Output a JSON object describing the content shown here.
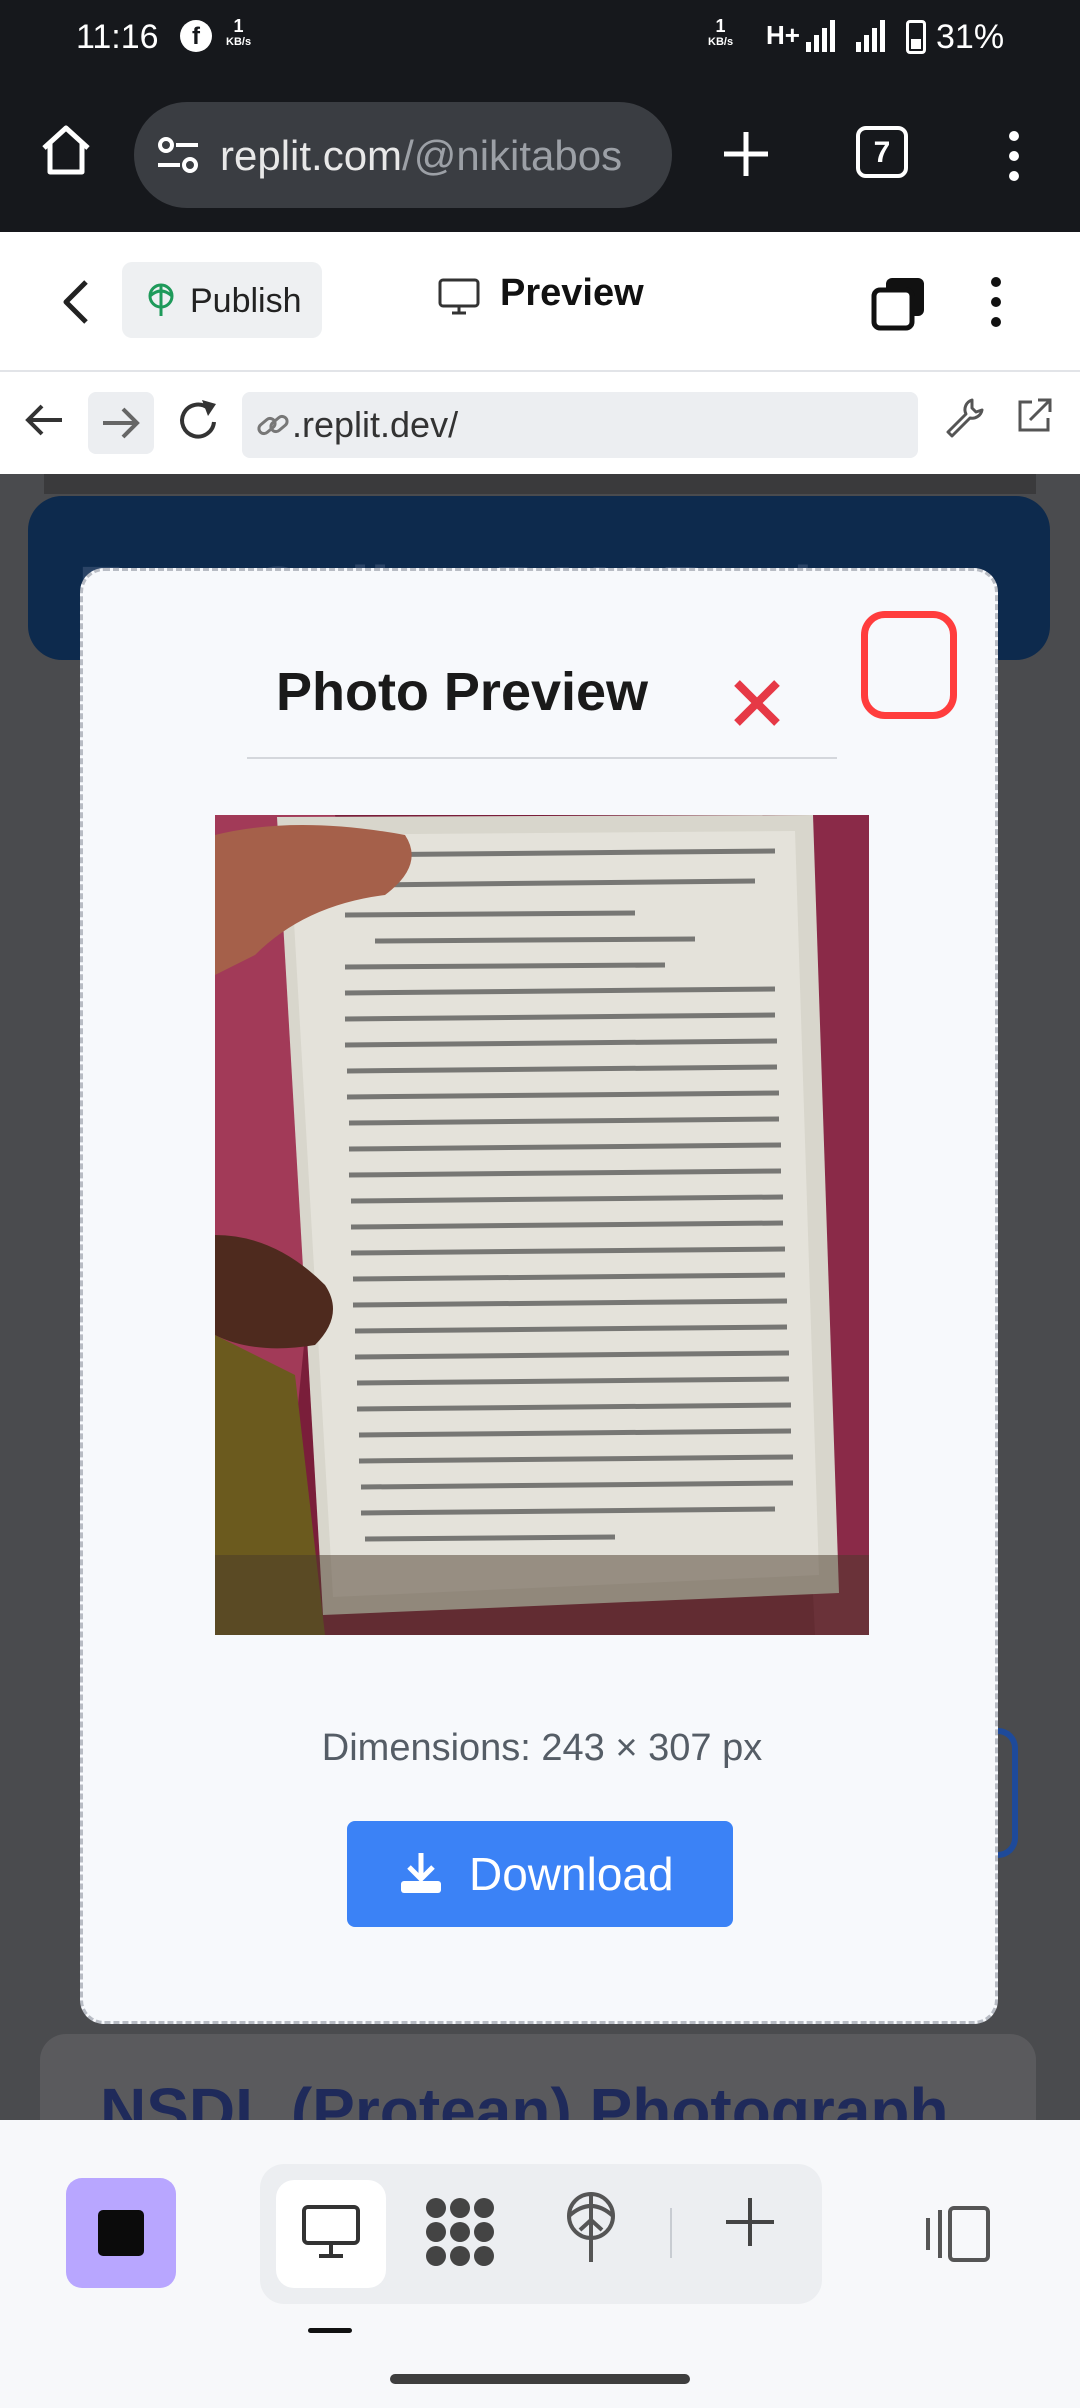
{
  "status_bar": {
    "time": "11:16",
    "net_speed_left": {
      "value": "1",
      "unit": "KB/s"
    },
    "net_speed_right": {
      "value": "1",
      "unit": "KB/s"
    },
    "network_type": "H+",
    "battery": "31%"
  },
  "browser": {
    "url_domain": "replit.com",
    "url_path": "/@nikitabos",
    "tab_count": "7"
  },
  "replit_header": {
    "publish_label": "Publish",
    "preview_label": "Preview"
  },
  "webview": {
    "url": ".replit.dev/"
  },
  "background_page": {
    "banner_text": "Free Online PAN Resizer",
    "section_heading": "NSDL (Protean) Photograph"
  },
  "modal": {
    "title": "Photo Preview",
    "dimensions_text": "Dimensions: 243 × 307 px",
    "download_label": "Download"
  },
  "colors": {
    "accent_blue": "#3b82f6",
    "close_red": "#e63946",
    "stop_purple": "#b8a6ff"
  }
}
